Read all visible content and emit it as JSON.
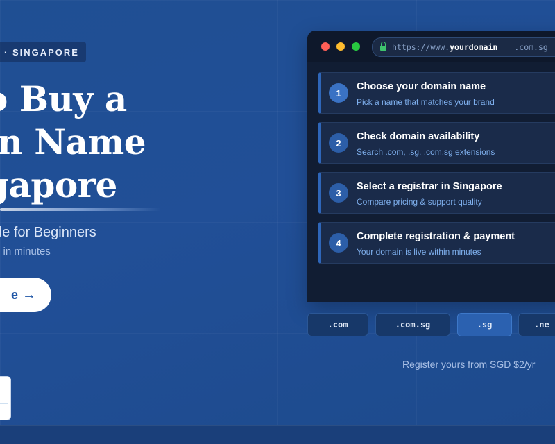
{
  "hero": {
    "tag": "· SINGAPORE",
    "title_lines": [
      "o Buy a",
      "in Name",
      "gapore"
    ],
    "subtitle": "de for Beginners",
    "caption": "n in minutes",
    "cta_label": "e",
    "cta_arrow": "→"
  },
  "browser": {
    "url_prefix": "https://www.",
    "url_domain": "yourdomain",
    "url_tld": ".com.sg",
    "steps": [
      {
        "number": "1",
        "title": "Choose your domain name",
        "description": "Pick a name that matches your brand"
      },
      {
        "number": "2",
        "title": "Check domain availability",
        "description": "Search .com, .sg, .com.sg extensions"
      },
      {
        "number": "3",
        "title": "Select a registrar in Singapore",
        "description": "Compare pricing & support quality"
      },
      {
        "number": "4",
        "title": "Complete registration & payment",
        "description": "Your domain is live within minutes"
      }
    ]
  },
  "extensions": [
    {
      "label": ".com",
      "active": false
    },
    {
      "label": ".com.sg",
      "active": false
    },
    {
      "label": ".sg",
      "active": true
    },
    {
      "label": ".ne",
      "active": false
    }
  ],
  "register_note": "Register yours from SGD $2/yr",
  "colors": {
    "background": "#214f97",
    "accent": "#2e66b9",
    "cta_text": "#1f56a6",
    "dot_red": "#ff5f57",
    "dot_yellow": "#febc2e",
    "dot_green": "#28c840"
  }
}
